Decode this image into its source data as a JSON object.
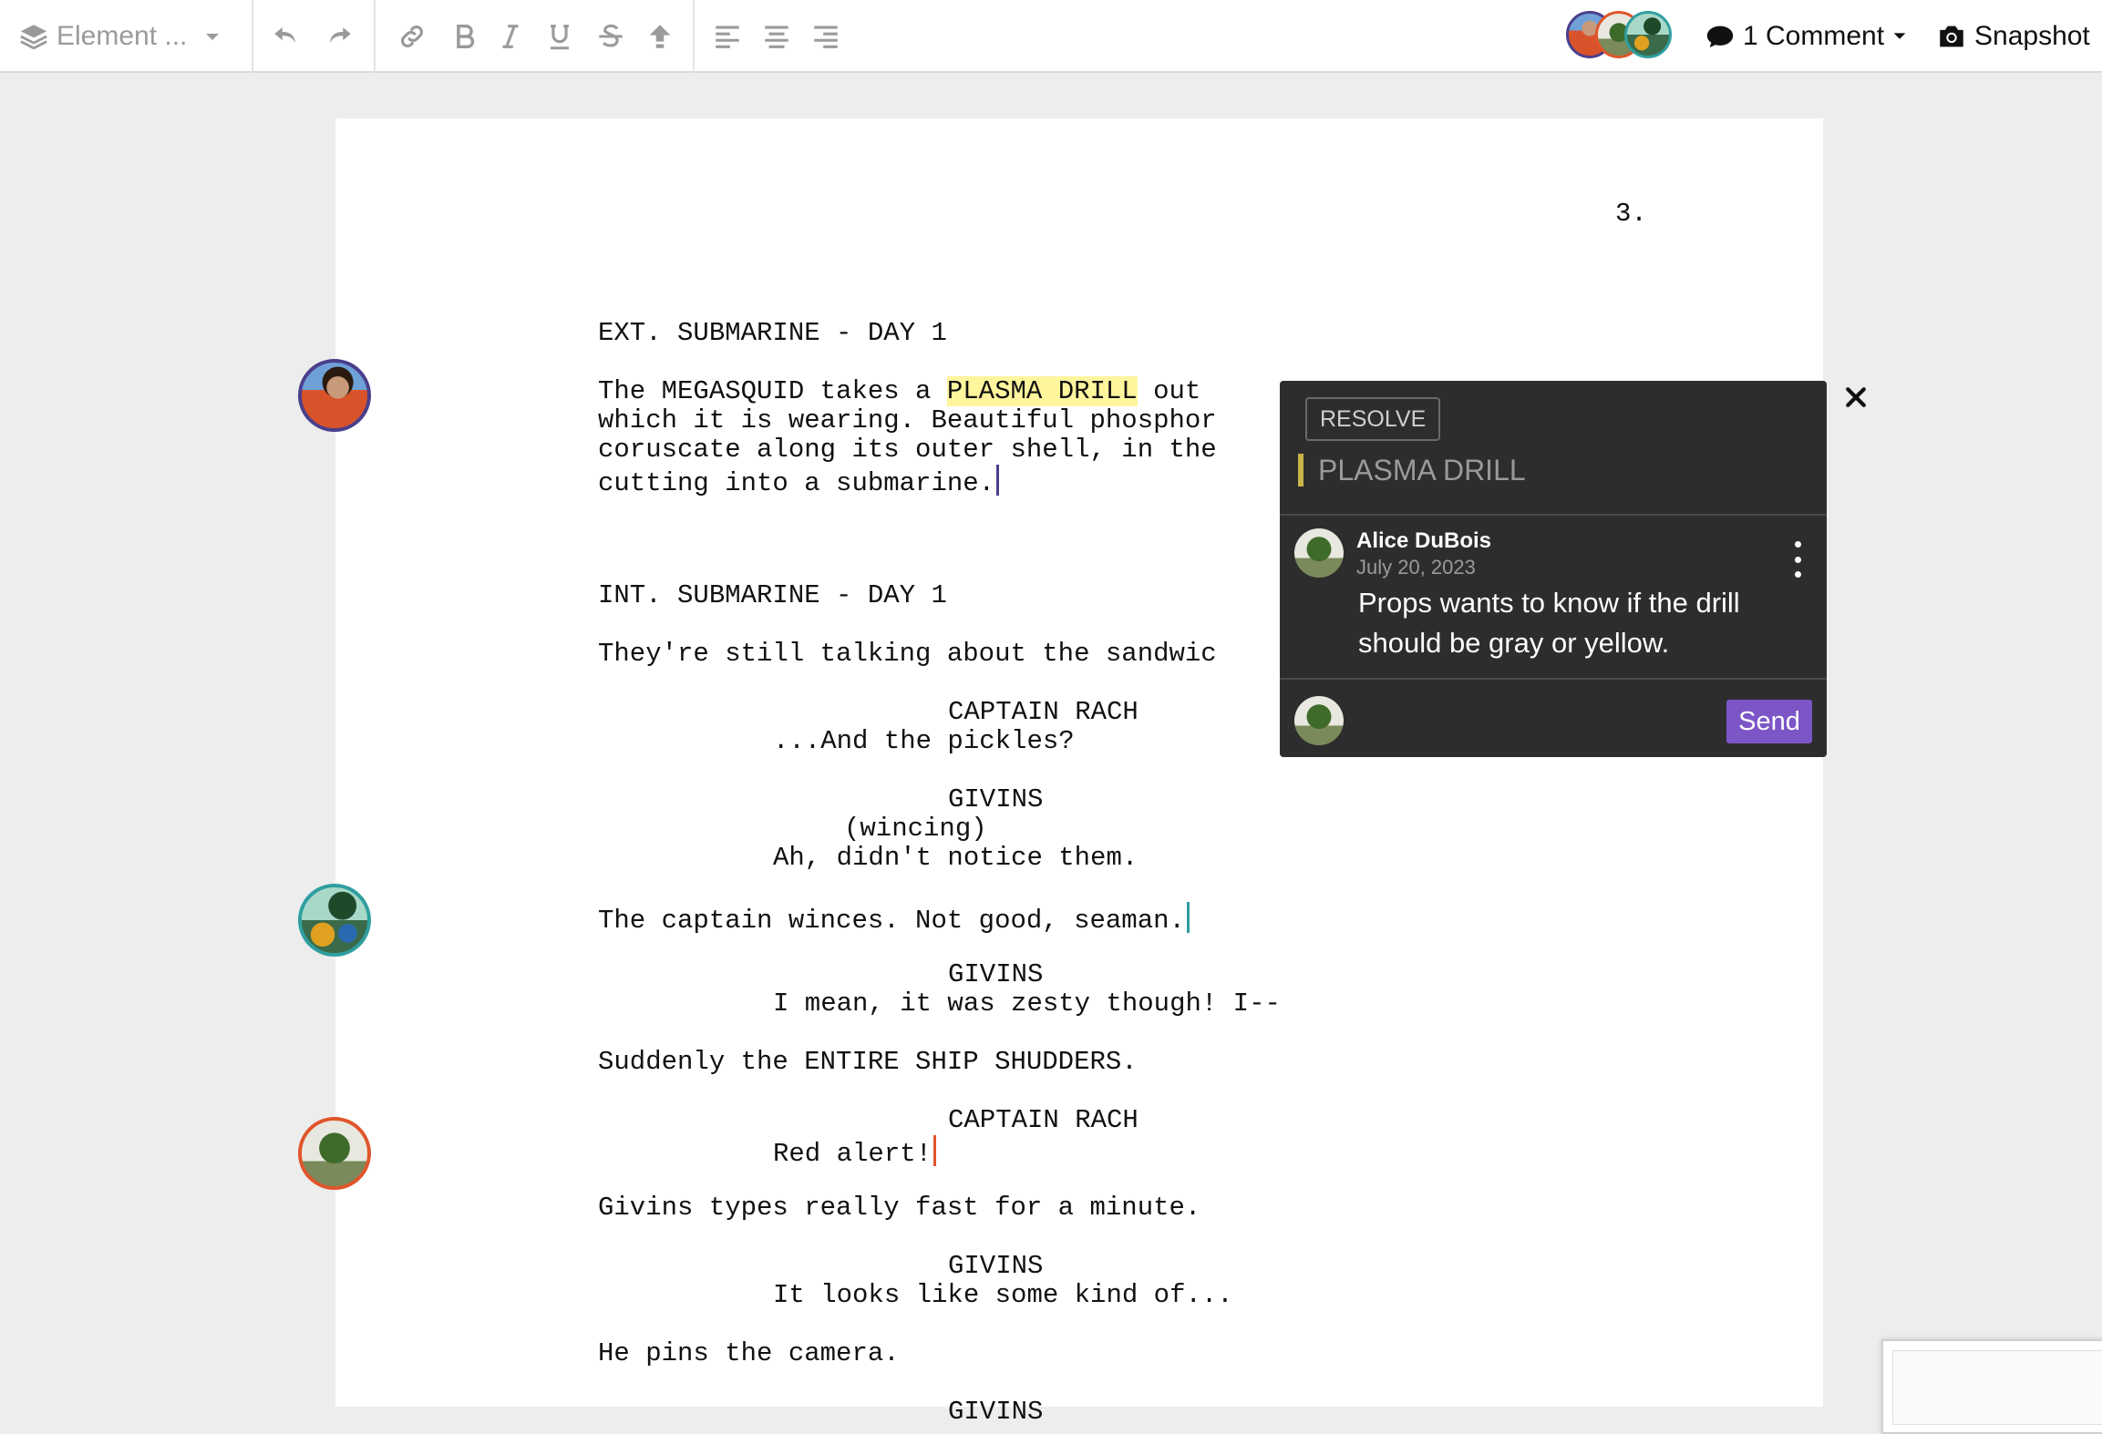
{
  "toolbar": {
    "element_select": "Element ...",
    "icons": [
      "layers-icon",
      "chevron-down-icon",
      "undo-icon",
      "redo-icon",
      "link-icon",
      "bold-icon",
      "italic-icon",
      "underline-icon",
      "strikethrough-icon",
      "upload-icon",
      "align-left-icon",
      "align-center-icon",
      "align-right-icon",
      "comment-icon",
      "camera-icon"
    ],
    "comments_label": "1 Comment",
    "snapshot_label": "Snapshot"
  },
  "page": {
    "number": "3."
  },
  "script": {
    "lines": [
      "EXT. SUBMARINE - DAY 1",
      "The MEGASQUID takes a ",
      "PLASMA DRILL",
      " out",
      "which it is wearing. Beautiful phosphor",
      "coruscate along its outer shell, in the",
      "cutting into a submarine.",
      "INT. SUBMARINE - DAY 1",
      "They're still talking about the sandwic",
      "CAPTAIN RACH",
      "...And the pickles?",
      "GIVINS",
      "(wincing)",
      "Ah, didn't notice them.",
      "The captain winces. Not good, seaman.",
      "GIVINS",
      "I mean, it was zesty though! I--",
      "Suddenly the ENTIRE SHIP SHUDDERS.",
      "CAPTAIN RACH",
      "Red alert!",
      "Givins types really fast for a minute.",
      "GIVINS",
      "It looks like some kind of...",
      "He pins the camera.",
      "GIVINS"
    ]
  },
  "comment": {
    "resolve_label": "RESOLVE",
    "quote": "PLASMA DRILL",
    "author": "Alice DuBois",
    "date": "July 20, 2023",
    "body": "Props wants to know if the drill should be gray or yellow.",
    "send_label": "Send"
  },
  "colors": {
    "highlight": "#fff59d",
    "caret_purple": "#4a3f8c",
    "caret_teal": "#2f9ea0",
    "caret_orange": "#e0552a",
    "send": "#7c55c7"
  }
}
